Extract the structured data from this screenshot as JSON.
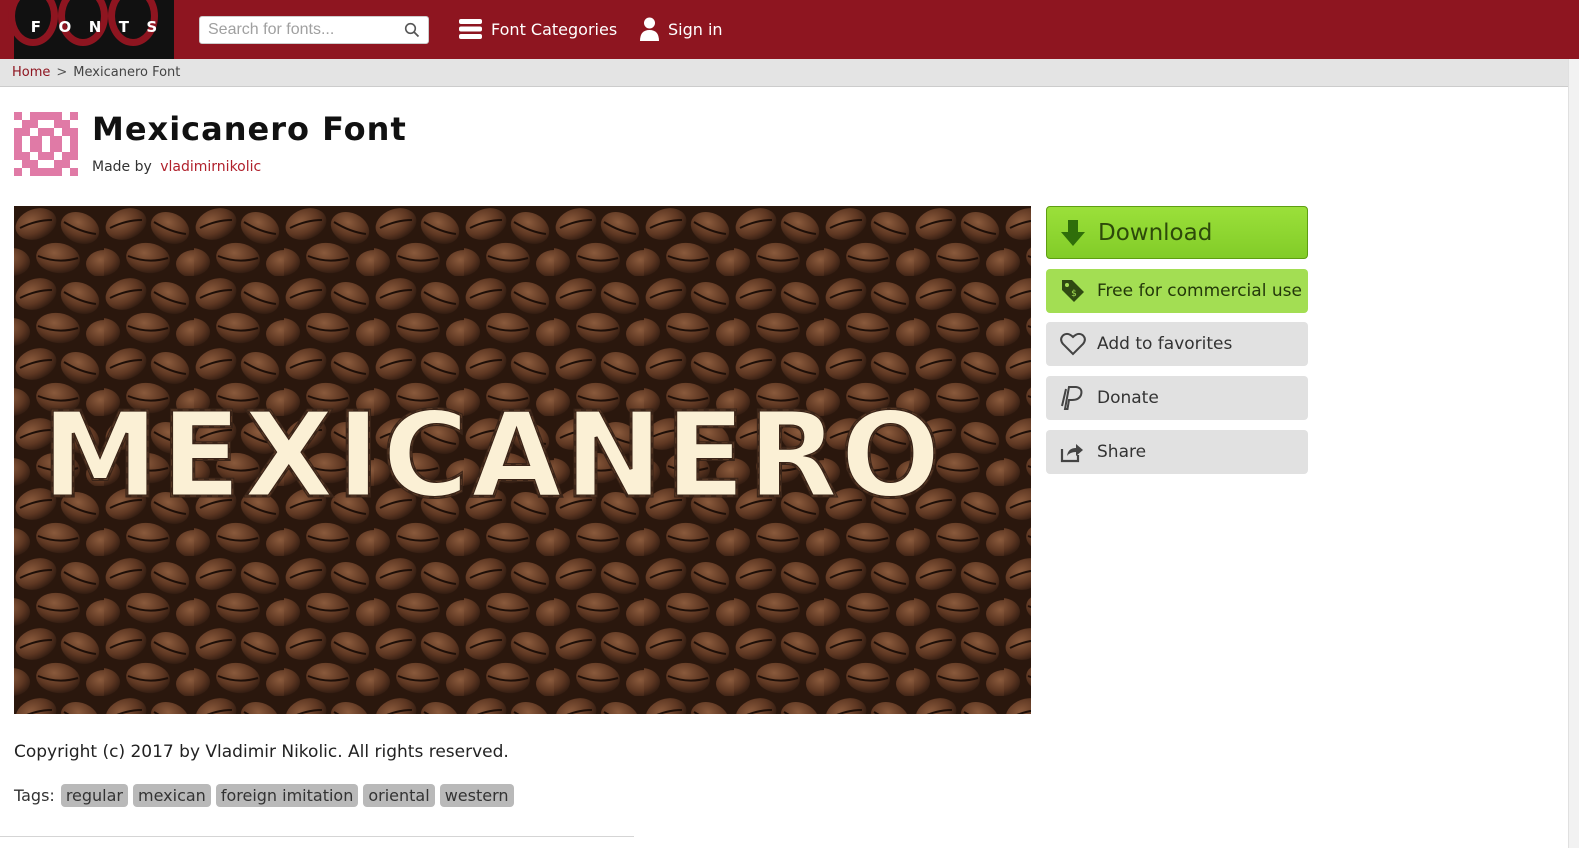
{
  "header": {
    "logo_letters": [
      "F",
      "O",
      "N",
      "T",
      "S"
    ],
    "search_placeholder": "Search for fonts...",
    "categories_label": "Font Categories",
    "signin_label": "Sign in"
  },
  "breadcrumb": {
    "home": "Home",
    "separator": ">",
    "current": "Mexicanero Font"
  },
  "font": {
    "title": "Mexicanero Font",
    "made_by_label": "Made by",
    "author": "vladimirnikolic",
    "preview_text": "MEXICANERO"
  },
  "sidebar": {
    "download": "Download",
    "license": "Free for commercial use",
    "favorites": "Add to favorites",
    "donate": "Donate",
    "share": "Share"
  },
  "copyright": "Copyright (c) 2017 by Vladimir Nikolic. All rights reserved.",
  "tags": {
    "label": "Tags:",
    "items": [
      "regular",
      "mexican",
      "foreign imitation",
      "oriental",
      "western"
    ]
  },
  "colors": {
    "header": "#8e1520",
    "link": "#b0202b",
    "download": "#8fd630",
    "license": "#a3de53",
    "avatar": "#e07aa6"
  }
}
